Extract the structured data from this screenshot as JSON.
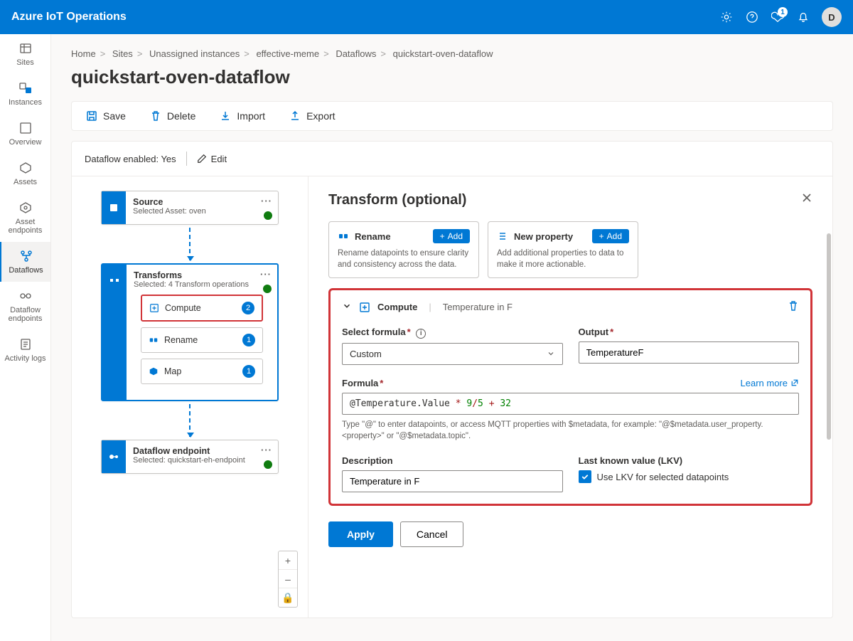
{
  "header": {
    "title": "Azure IoT Operations",
    "avatar_initial": "D",
    "notif_badge": "1"
  },
  "leftnav": {
    "sites": "Sites",
    "instances": "Instances",
    "overview": "Overview",
    "assets": "Assets",
    "asset_endpoints": "Asset endpoints",
    "dataflows": "Dataflows",
    "dataflow_endpoints": "Dataflow endpoints",
    "activity_logs": "Activity logs"
  },
  "breadcrumbs": {
    "home": "Home",
    "sites": "Sites",
    "unassigned": "Unassigned instances",
    "instance": "effective-meme",
    "dataflows": "Dataflows",
    "current": "quickstart-oven-dataflow"
  },
  "page_title": "quickstart-oven-dataflow",
  "toolbar": {
    "save": "Save",
    "delete": "Delete",
    "import": "Import",
    "export": "Export"
  },
  "workspace": {
    "enabled_label": "Dataflow enabled: Yes",
    "edit_label": "Edit"
  },
  "nodes": {
    "source": {
      "title": "Source",
      "sub": "Selected Asset: oven"
    },
    "transforms": {
      "title": "Transforms",
      "sub": "Selected: 4 Transform operations",
      "ops": {
        "compute": {
          "label": "Compute",
          "count": "2"
        },
        "rename": {
          "label": "Rename",
          "count": "1"
        },
        "map": {
          "label": "Map",
          "count": "1"
        }
      }
    },
    "dest": {
      "title": "Dataflow endpoint",
      "sub": "Selected: quickstart-eh-endpoint"
    }
  },
  "panel": {
    "title": "Transform (optional)",
    "rename_card": {
      "title": "Rename",
      "add": "Add",
      "desc": "Rename datapoints to ensure clarity and consistency across the data."
    },
    "newprop_card": {
      "title": "New property",
      "add": "Add",
      "desc": "Add additional properties to data to make it more actionable."
    },
    "form": {
      "head_label": "Compute",
      "head_value": "Temperature in F",
      "select_formula_label": "Select formula",
      "select_formula_value": "Custom",
      "output_label": "Output",
      "output_value": "TemperatureF",
      "formula_label": "Formula",
      "learn_more": "Learn more",
      "formula_prefix": "@Temperature.Value",
      "hint": "Type \"@\" to enter datapoints, or access MQTT properties with $metadata, for example: \"@$metadata.user_property.<property>\" or \"@$metadata.topic\".",
      "description_label": "Description",
      "description_value": "Temperature in F",
      "lkv_label": "Last known value (LKV)",
      "lkv_check": "Use LKV for selected datapoints"
    },
    "apply": "Apply",
    "cancel": "Cancel"
  },
  "map_controls": {
    "plus": "+",
    "minus": "–",
    "lock": "🔒"
  }
}
